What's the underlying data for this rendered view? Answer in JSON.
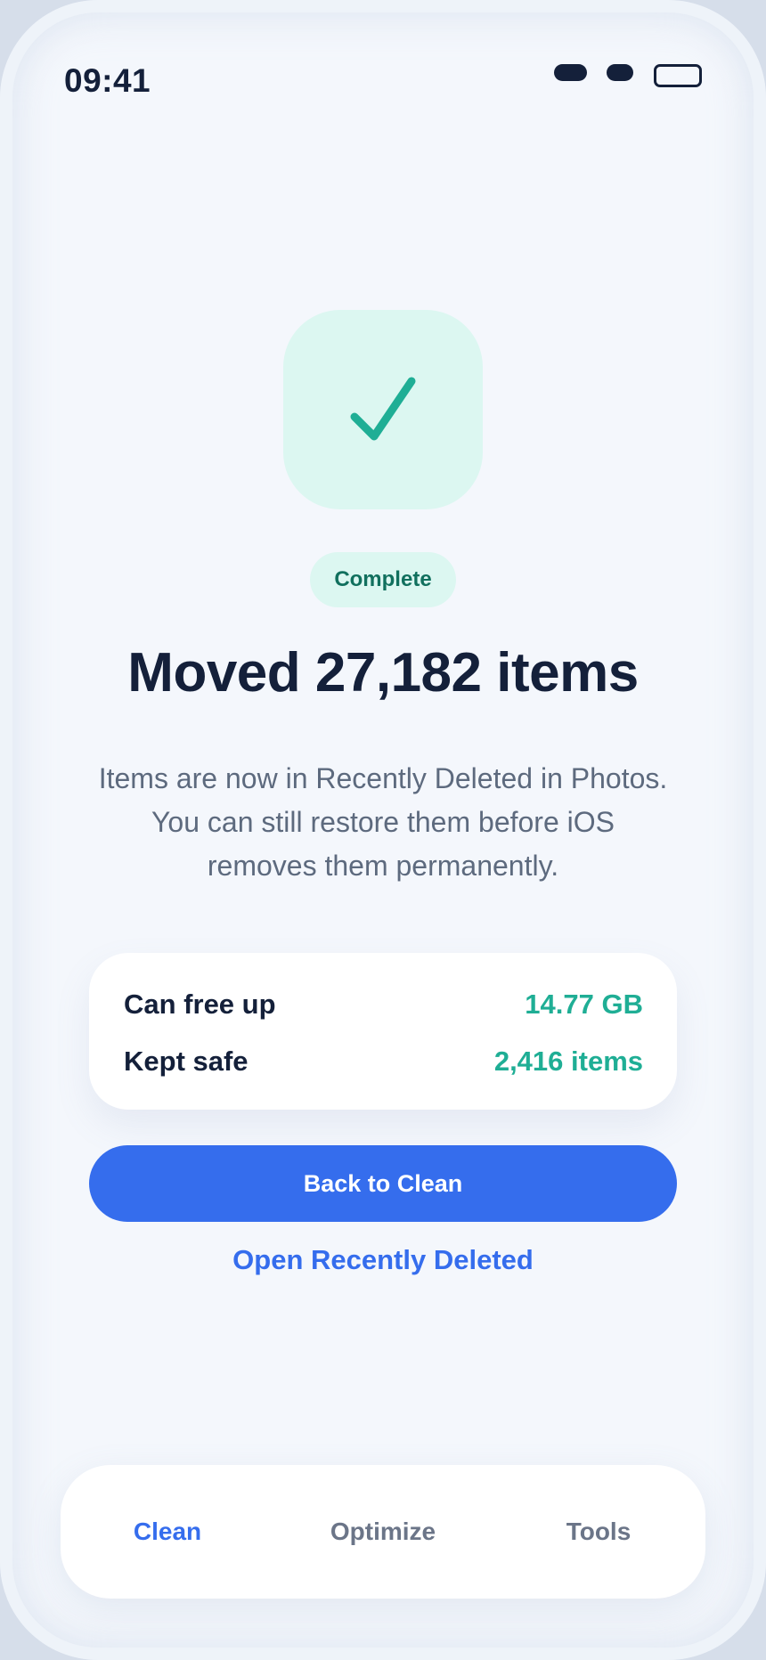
{
  "status_bar": {
    "time": "09:41"
  },
  "hero": {
    "icon": "checkmark-icon",
    "accent_color": "#1fae95",
    "background": "#dcf7f1"
  },
  "badge": {
    "label": "Complete"
  },
  "title": "Moved 27,182 items",
  "subtitle": "Items are now in Recently Deleted in Photos. You can still restore them before iOS removes them permanently.",
  "stats": [
    {
      "label": "Can free up",
      "value": "14.77 GB"
    },
    {
      "label": "Kept safe",
      "value": "2,416 items"
    }
  ],
  "primary_button": {
    "label": "Back to Clean",
    "color": "#356ded"
  },
  "secondary_link": {
    "label": "Open Recently Deleted"
  },
  "tabs": [
    {
      "label": "Clean",
      "active": true
    },
    {
      "label": "Optimize",
      "active": false
    },
    {
      "label": "Tools",
      "active": false
    }
  ]
}
